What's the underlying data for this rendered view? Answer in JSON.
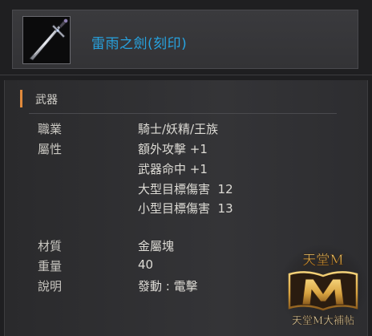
{
  "item": {
    "name": "雷雨之劍(刻印)",
    "icon": "sword-icon"
  },
  "category": "武器",
  "properties": [
    {
      "label": "職業",
      "value": "騎士/妖精/王族"
    },
    {
      "label": "屬性",
      "values": [
        "額外攻擊 +1",
        "武器命中 +1",
        "大型目標傷害  12",
        "小型目標傷害  13"
      ]
    },
    {
      "label": "材質",
      "value": "金屬塊"
    },
    {
      "label": "重量",
      "value": "40"
    },
    {
      "label": "說明",
      "value": "發動 : 電擊"
    }
  ],
  "watermark": {
    "top_text": "天堂M",
    "bottom_text": "天堂M大補帖"
  },
  "colors": {
    "item_name": "#27a3e0",
    "category_accent": "#e08a3c",
    "watermark_gold": "#d9a441"
  }
}
